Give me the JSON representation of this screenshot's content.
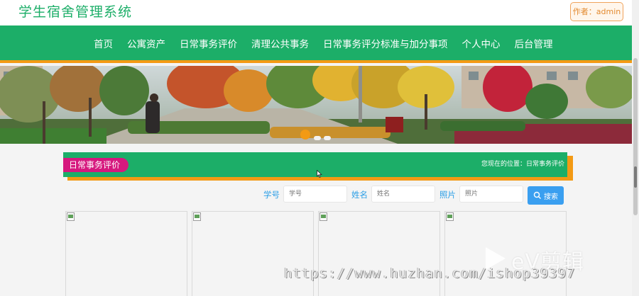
{
  "header": {
    "site_title": "学生宿舍管理系统",
    "author_badge": "作者：admin"
  },
  "nav": {
    "items": [
      "首页",
      "公寓资产",
      "日常事务评价",
      "清理公共事务",
      "日常事务评分标准与加分事项",
      "个人中心",
      "后台管理"
    ]
  },
  "banner": {
    "slide_count": 3,
    "active_slide": 1
  },
  "section": {
    "title": "日常事务评价",
    "breadcrumb": "您现在的位置：日常事务评价"
  },
  "search": {
    "fields": [
      {
        "label": "学号",
        "placeholder": "学号"
      },
      {
        "label": "姓名",
        "placeholder": "姓名"
      },
      {
        "label": "照片",
        "placeholder": "照片"
      }
    ],
    "button_label": "搜索"
  },
  "cards": {
    "count": 4
  },
  "watermark": {
    "logo": "eV剪辑",
    "url": "https://www.huzhan.com/ishop39397"
  },
  "colors": {
    "brand_green": "#1cae68",
    "accent_orange": "#f39a14",
    "pill_magenta": "#d6187e",
    "search_blue": "#3a9ff0",
    "label_blue": "#2a9ee6"
  }
}
